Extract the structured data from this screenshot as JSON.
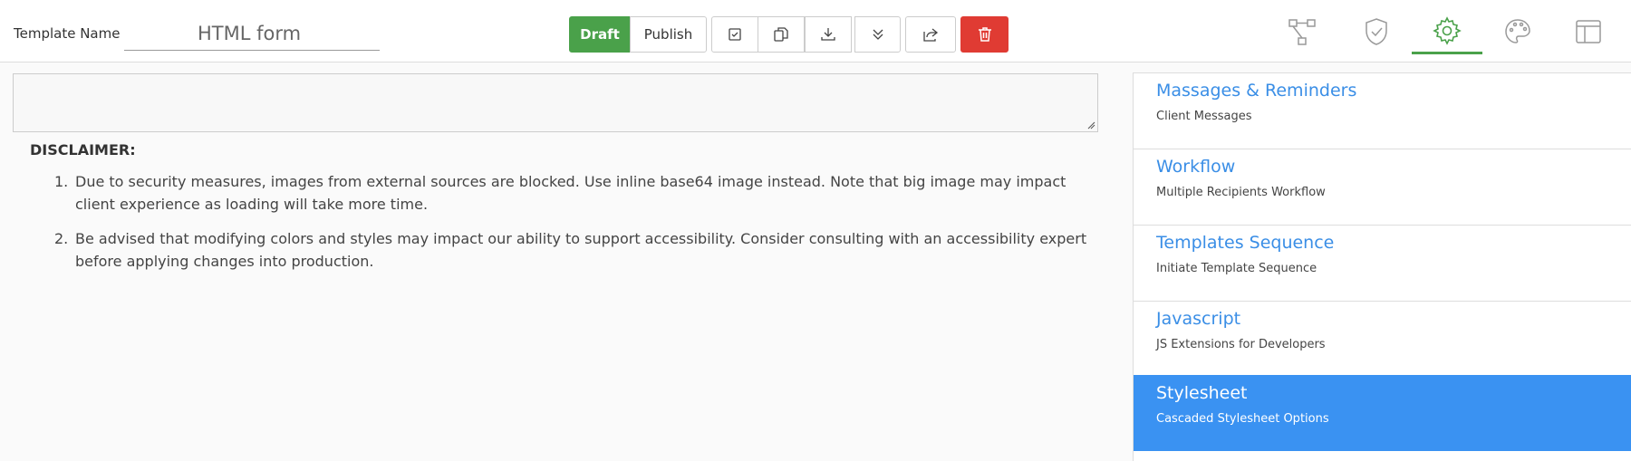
{
  "header": {
    "template_name_label": "Template Name",
    "template_name_value": "HTML form",
    "draft_label": "Draft",
    "publish_label": "Publish"
  },
  "toolbar_icons": [
    "checkbox-icon",
    "copy-icon",
    "download-icon",
    "double-chevron-down-icon",
    "share-icon",
    "trash-icon"
  ],
  "tabs": [
    "workflow-tree-icon",
    "shield-check-icon",
    "gear-icon",
    "palette-icon",
    "layout-icon"
  ],
  "active_tab": "gear-icon",
  "disclaimer": {
    "title": "DISCLAIMER:",
    "items": [
      {
        "num": "1.",
        "text": "Due to security measures, images from external sources are blocked. Use inline base64 image instead. Note that big image may impact client experience as loading will take more time."
      },
      {
        "num": "2.",
        "text": "Be advised that modifying colors and styles may impact our ability to support accessibility. Consider consulting with an accessibility expert before applying changes into production."
      }
    ]
  },
  "panel": {
    "items": [
      {
        "title": "Massages & Reminders",
        "subtitle": "Client Messages"
      },
      {
        "title": "Workflow",
        "subtitle": "Multiple Recipients Workflow"
      },
      {
        "title": "Templates Sequence",
        "subtitle": "Initiate Template Sequence"
      },
      {
        "title": "Javascript",
        "subtitle": "JS Extensions for Developers"
      },
      {
        "title": "Stylesheet",
        "subtitle": "Cascaded Stylesheet Options"
      }
    ],
    "active_item": "Stylesheet"
  },
  "colors": {
    "accent_green": "#4aa14a",
    "delete_red": "#e03b33",
    "link_blue": "#3a8ee6",
    "active_blue": "#3a92f2"
  }
}
